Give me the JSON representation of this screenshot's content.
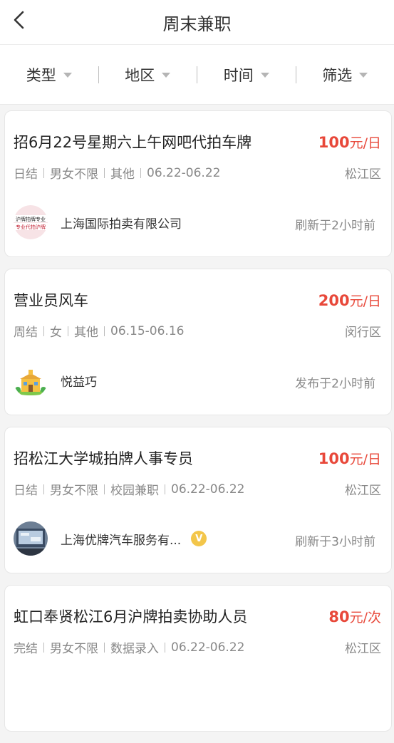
{
  "header": {
    "title": "周末兼职",
    "back_icon": "chevron-left-icon"
  },
  "filters": [
    {
      "label": "类型"
    },
    {
      "label": "地区"
    },
    {
      "label": "时间"
    },
    {
      "label": "筛选"
    }
  ],
  "colors": {
    "salary": "#e8483a",
    "muted": "#888888",
    "badge": "#f3c64a"
  },
  "jobs": [
    {
      "title": "招6月22号星期六上午网吧代拍车牌",
      "salary_amount": "100",
      "salary_unit": "元/日",
      "tags": [
        "日结",
        "男女不限",
        "其他",
        "06.22-06.22"
      ],
      "district": "松江区",
      "company": "上海国际拍卖有限公司",
      "logo_text": [
        "沪牌拍牌专业",
        "专业代拍沪牌"
      ],
      "verified": false,
      "posted": "刷新于2小时前"
    },
    {
      "title": "营业员风车",
      "salary_amount": "200",
      "salary_unit": "元/日",
      "tags": [
        "周结",
        "女",
        "其他",
        "06.15-06.16"
      ],
      "district": "闵行区",
      "company": "悦益巧",
      "verified": false,
      "posted": "发布于2小时前"
    },
    {
      "title": "招松江大学城拍牌人事专员",
      "salary_amount": "100",
      "salary_unit": "元/日",
      "tags": [
        "日结",
        "男女不限",
        "校园兼职",
        "06.22-06.22"
      ],
      "district": "松江区",
      "company": "上海优牌汽车服务有...",
      "verified": true,
      "verified_label": "V",
      "posted": "刷新于3小时前"
    },
    {
      "title": "虹口奉贤松江6月沪牌拍卖协助人员",
      "salary_amount": "80",
      "salary_unit": "元/次",
      "tags": [
        "完结",
        "男女不限",
        "数据录入",
        "06.22-06.22"
      ],
      "district": "松江区"
    }
  ]
}
